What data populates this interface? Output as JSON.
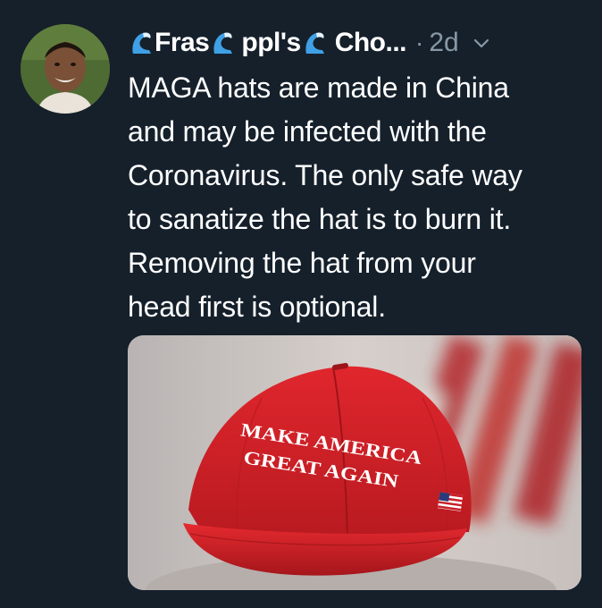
{
  "tweet": {
    "author_name_parts": [
      "Fras",
      "ppl's",
      "Cho..."
    ],
    "separator": "·",
    "time": "2d",
    "text_lines": [
      "MAGA hats are made in China",
      "and may be infected with the",
      "Coronavirus. The only safe way",
      "to sanatize the hat is to burn it.",
      "Removing the hat from your",
      "head first is optional."
    ],
    "media": {
      "hat_text_line1": "MAKE AMERICA",
      "hat_text_line2": "GREAT AGAIN"
    }
  },
  "icons": {
    "emoji": "wave-emoji-icon",
    "menu": "chevron-down-icon"
  },
  "colors": {
    "background": "#15202b",
    "secondary_text": "#8899a6",
    "emoji_blue": "#3fa0e6",
    "hat_red": "#d8232a"
  }
}
